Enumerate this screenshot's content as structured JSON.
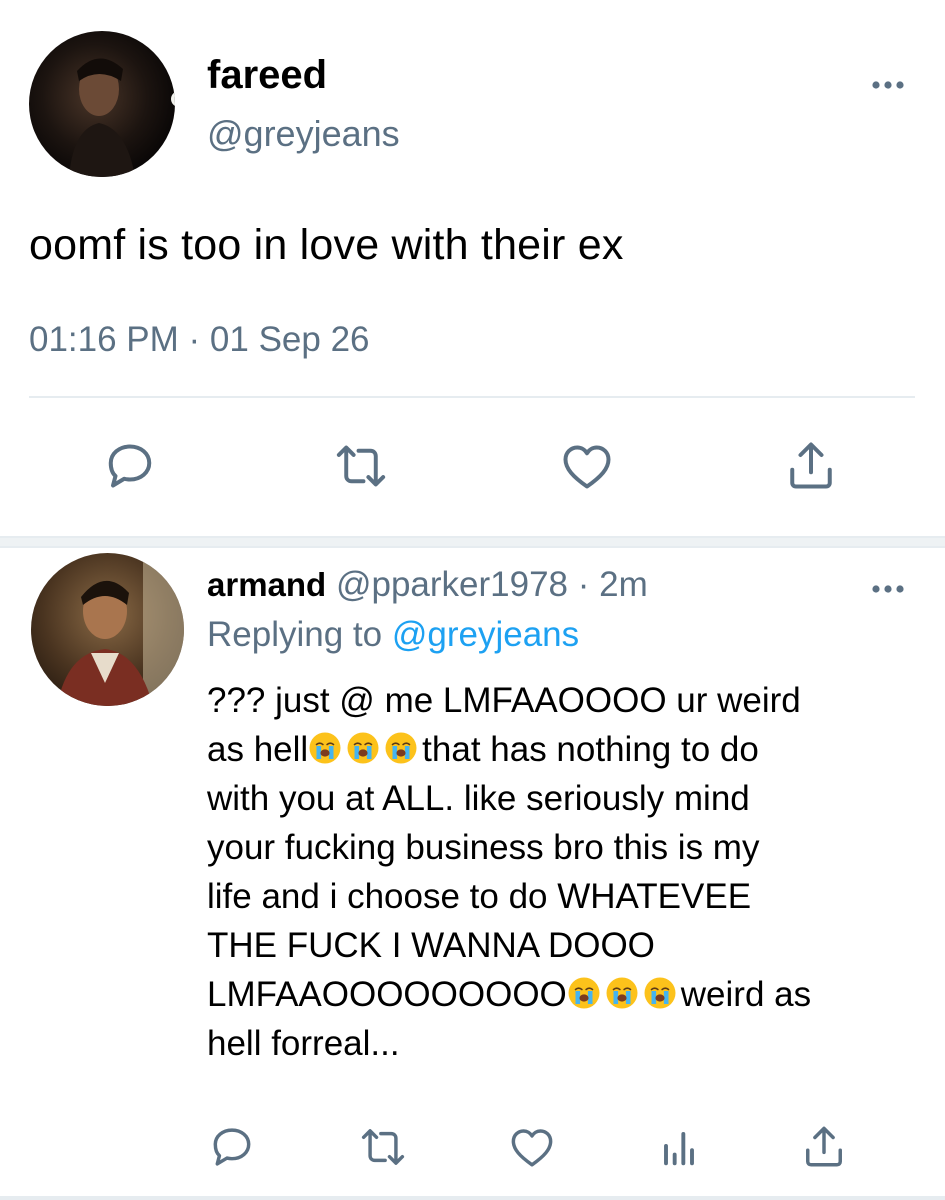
{
  "tweet": {
    "name": "fareed",
    "handle": "@greyjeans",
    "text": "oomf is too in love with their ex",
    "timestamp": "01:16 PM · 01 Sep 26",
    "actions": [
      "reply-icon",
      "retweet-icon",
      "like-icon",
      "share-icon"
    ]
  },
  "reply": {
    "name": "armand",
    "handle": "@pparker1978",
    "separator": "·",
    "age": "2m",
    "replying_prefix": "Replying to",
    "replying_handle": "@greyjeans",
    "emoji": "loudly-crying-face",
    "lines": {
      "l1": "??? just @ me LMFAAOOOO ur weird",
      "l2a": "as hell",
      "l2b": "that has nothing to do",
      "l3": "with you at ALL. like seriously mind",
      "l4": "your fucking business bro this is my",
      "l5": "life and i choose to do WHATEVEE",
      "l6": "THE FUCK I WANNA DOOO",
      "l7a": "LMFAAOOOOOOOOO",
      "l7b": "weird as",
      "l8": "hell forreal..."
    },
    "actions": [
      "reply-icon",
      "retweet-icon",
      "like-icon",
      "analytics-icon",
      "share-icon"
    ]
  },
  "colors": {
    "text": "#000000",
    "secondary": "#5b7083",
    "link": "#1da1f2",
    "divider": "#e6ecf0"
  }
}
